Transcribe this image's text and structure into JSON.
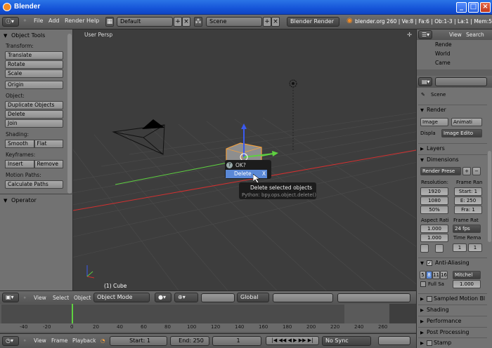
{
  "window": {
    "title": "Blender"
  },
  "infobar": {
    "menus": [
      "File",
      "Add",
      "Render",
      "Help"
    ],
    "screen_layout": "Default",
    "scene": "Scene",
    "render_engine": "Blender Render",
    "stats": "blender.org 260 | Ve:8 | Fa:6 | Ob:1-3 | La:1 | Mem:5.35M |"
  },
  "toolshelf": {
    "title": "Object Tools",
    "transform_label": "Transform:",
    "translate": "Translate",
    "rotate": "Rotate",
    "scale": "Scale",
    "origin": "Origin",
    "object_label": "Object:",
    "duplicate": "Duplicate Objects",
    "delete": "Delete",
    "join": "Join",
    "shading_label": "Shading:",
    "smooth": "Smooth",
    "flat": "Flat",
    "keyframes_label": "Keyframes:",
    "insert": "Insert",
    "remove": "Remove",
    "motion_label": "Motion Paths:",
    "calc_paths": "Calculate Paths",
    "operator": "Operator"
  },
  "viewport": {
    "label": "User Persp",
    "object_label": "(1) Cube",
    "popup": {
      "title": "OK?",
      "item": "Delete",
      "close": "X"
    },
    "tooltip": {
      "title": "Delete selected objects",
      "python": "Python: bpy.ops.object.delete()"
    }
  },
  "viewheader": {
    "menus": [
      "View",
      "Select",
      "Object"
    ],
    "mode": "Object Mode",
    "orientation": "Global"
  },
  "timeline": {
    "ticks": [
      "-40",
      "-20",
      "0",
      "20",
      "40",
      "60",
      "80",
      "100",
      "120",
      "140",
      "160",
      "180",
      "200",
      "220",
      "240",
      "260"
    ],
    "menus": [
      "View",
      "Frame",
      "Playback"
    ],
    "start": "Start: 1",
    "end": "End: 250",
    "current": "1",
    "sync": "No Sync"
  },
  "outliner": {
    "view": "View",
    "search": "Search",
    "items": [
      "Rende",
      "World",
      "Came"
    ]
  },
  "properties": {
    "context": "Scene",
    "render": "Render",
    "image_btn": "Image",
    "anim_btn": "Animati",
    "display_label": "Displa",
    "display_value": "Image Edito",
    "layers": "Layers",
    "dimensions": "Dimensions",
    "preset": "Render Prese",
    "resolution": "Resolution:",
    "res_x": "1920",
    "res_y": "1080",
    "res_pct": "50%",
    "frame_range": "Frame Ran",
    "start": "Start: 1",
    "end": "E: 250",
    "step": "Fra: 1",
    "aspect": "Aspect Rati",
    "aspect_x": "1.000",
    "aspect_y": "1.000",
    "frame_rate": "Frame Rat",
    "fps": "24 fps",
    "time_remap": "Time Rema",
    "remap_old": "1",
    "remap_new": "1",
    "antialiasing": "Anti-Aliasing",
    "aa_samples": [
      "5",
      "8",
      "11",
      "16"
    ],
    "aa_filter": "Mitchel",
    "full_sample": "Full Sa",
    "aa_size": "1.000",
    "sampled_motion": "Sampled Motion Bl",
    "shading": "Shading",
    "performance": "Performance",
    "post_processing": "Post Processing",
    "stamp": "Stamp"
  },
  "colors": {
    "titlebar": "#1554d8",
    "selection": "#5a88d6",
    "x_axis": "#d43030",
    "y_axis": "#5ed040",
    "z_axis": "#3a5af0",
    "cube_outline": "#f0a040"
  }
}
